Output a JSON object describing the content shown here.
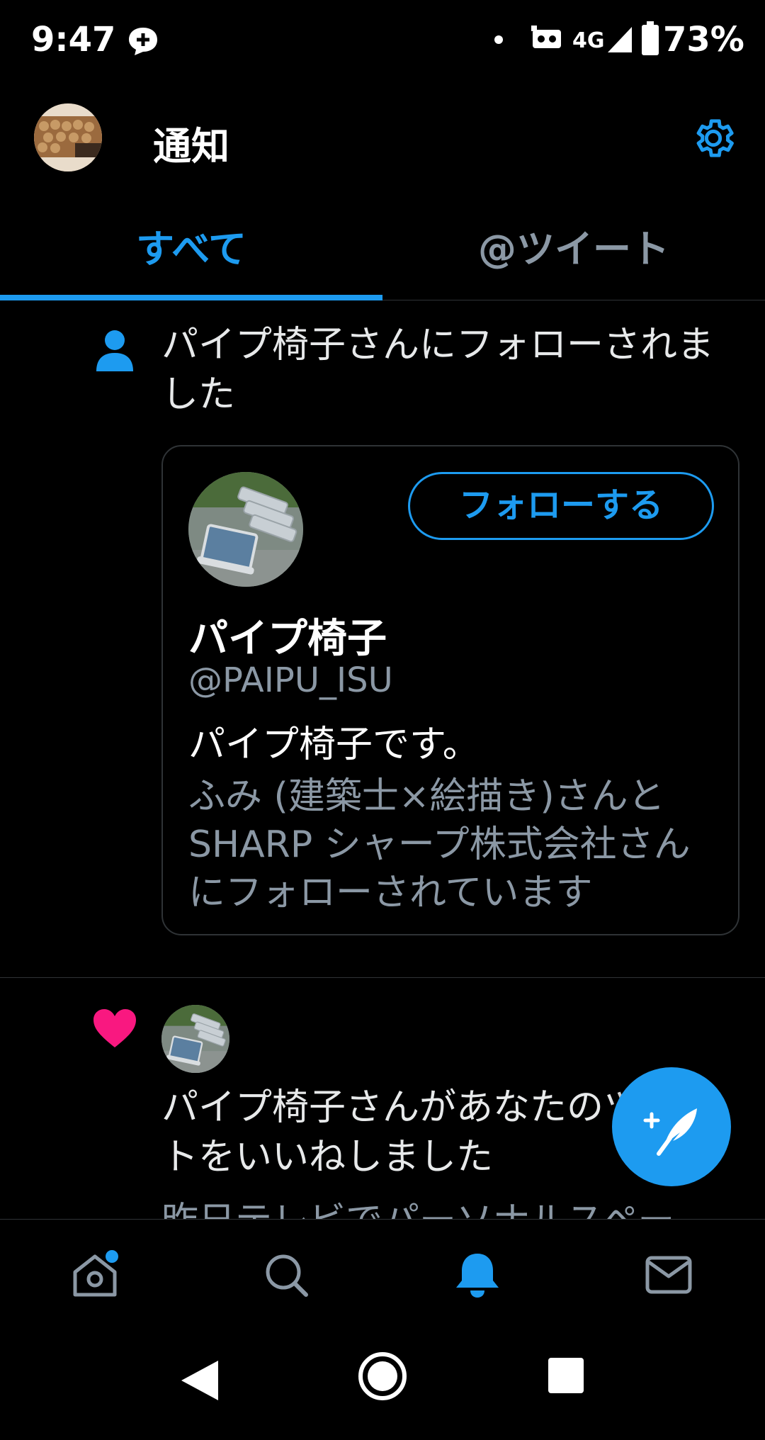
{
  "status_bar": {
    "time": "9:47",
    "network": "4G",
    "battery": "73%"
  },
  "header": {
    "title": "通知"
  },
  "tabs": [
    {
      "label": "すべて",
      "active": true
    },
    {
      "label": "@ツイート",
      "active": false
    }
  ],
  "notifications": [
    {
      "type": "follow",
      "icon": "person-icon",
      "text": "パイプ椅子さんにフォローされました",
      "card": {
        "name": "パイプ椅子",
        "handle": "@PAIPU_ISU",
        "bio": "パイプ椅子です。",
        "followed_by": "ふみ (建築士×絵描き)さんとSHARP シャープ株式会社さんにフォローされています",
        "follow_button": "フォローする"
      }
    },
    {
      "type": "like",
      "icon": "heart-icon",
      "text": "パイプ椅子さんがあなたのツイートをいいねしました",
      "snippet": "昨日テレビでパーソナルスペー"
    }
  ],
  "colors": {
    "accent": "#1d9bf0",
    "like": "#f91880",
    "secondary_text": "#8b98a5",
    "background": "#000000"
  },
  "bottom_nav": [
    {
      "icon": "home-icon",
      "has_badge": true
    },
    {
      "icon": "search-icon"
    },
    {
      "icon": "bell-icon",
      "active": true
    },
    {
      "icon": "mail-icon"
    }
  ]
}
